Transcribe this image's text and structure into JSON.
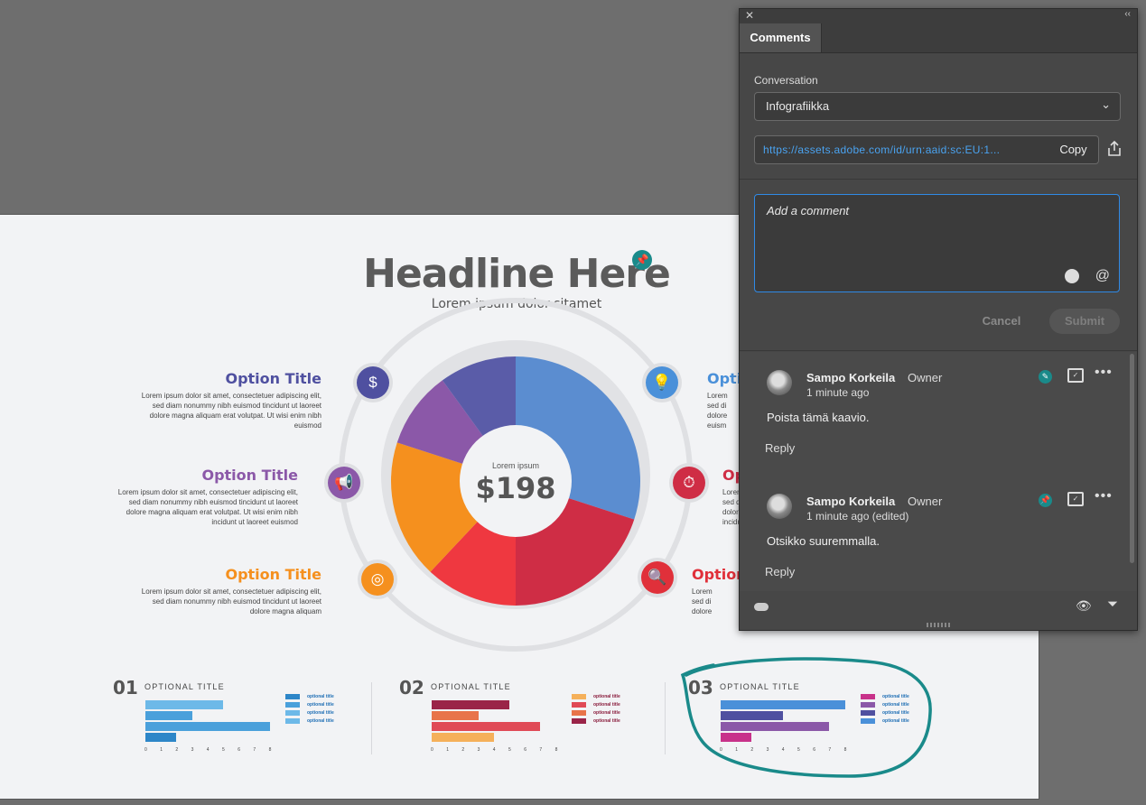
{
  "artboard": {
    "headline": "Headline Here",
    "subheadline": "Lorem ipsum dolor sitamet",
    "donut": {
      "center_label": "Lorem ipsum",
      "center_value": "$198",
      "slices": [
        {
          "value": 30,
          "color": "#5b8dd0"
        },
        {
          "value": 20,
          "color": "#cf2d45"
        },
        {
          "value": 12,
          "color": "#ef3840"
        },
        {
          "value": 18,
          "color": "#f5901e"
        },
        {
          "value": 10,
          "color": "#8b58a8"
        },
        {
          "value": 10,
          "color": "#5a5ca8"
        }
      ]
    },
    "options_left": [
      {
        "title": "Option Title",
        "color": "#4f50a0",
        "icon": "dollar-icon",
        "body": "Lorem ipsum dolor sit amet, consectetuer adipiscing elit, sed diam nonummy nibh euismod tincidunt ut laoreet dolore magna aliquam erat volutpat. Ut wisi enim nibh euismod"
      },
      {
        "title": "Option Title",
        "color": "#8b58a8",
        "icon": "megaphone-icon",
        "body": "Lorem ipsum dolor sit amet, consectetuer adipiscing elit, sed diam nonummy nibh euismod tincidunt ut laoreet dolore magna aliquam erat volutpat. Ut wisi enim nibh incidunt ut laoreet euismod"
      },
      {
        "title": "Option Title",
        "color": "#f5901e",
        "icon": "target-icon",
        "body": "Lorem ipsum dolor sit amet, consectetuer adipiscing elit, sed diam nonummy nibh euismod tincidunt ut laoreet dolore magna aliquam"
      }
    ],
    "options_right": [
      {
        "title": "Optio",
        "color": "#4a90d9",
        "icon": "lightbulb-icon",
        "body": "Lorem\nsed di\ndolore\neuism"
      },
      {
        "title": "Op",
        "color": "#cf2d45",
        "icon": "stopwatch-icon",
        "body": "Lorem\nsed di\ndolore\nincidu"
      },
      {
        "title": "Option",
        "color": "#e0303a",
        "icon": "magnifier-icon",
        "body": "Lorem\nsed di\ndolore"
      }
    ],
    "mini_charts": [
      {
        "number": "01",
        "title": "OPTIONAL TITLE",
        "legend_color": "#1f6fb5",
        "bars": [
          {
            "value": 5,
            "color": "#6db9e8"
          },
          {
            "value": 3,
            "color": "#4aa0db"
          },
          {
            "value": 8,
            "color": "#4aa0db"
          },
          {
            "value": 2,
            "color": "#2d86c8"
          }
        ],
        "legend_colors": [
          "#2d86c8",
          "#4aa0db",
          "#6db9e8",
          "#6db9e8"
        ]
      },
      {
        "number": "02",
        "title": "OPTIONAL TITLE",
        "legend_color": "#8a1d3d",
        "bars": [
          {
            "value": 5,
            "color": "#9a2448"
          },
          {
            "value": 3,
            "color": "#e8744a"
          },
          {
            "value": 7,
            "color": "#e04a56"
          },
          {
            "value": 4,
            "color": "#f5b05a"
          }
        ],
        "legend_colors": [
          "#f5b05a",
          "#e04a56",
          "#e8744a",
          "#9a2448"
        ]
      },
      {
        "number": "03",
        "title": "OPTIONAL TITLE",
        "legend_color": "#1f6fb5",
        "bars": [
          {
            "value": 8,
            "color": "#4a90d9"
          },
          {
            "value": 4,
            "color": "#4f50a0"
          },
          {
            "value": 7,
            "color": "#8b58a8"
          },
          {
            "value": 2,
            "color": "#c8328a"
          }
        ],
        "legend_colors": [
          "#c8328a",
          "#8b58a8",
          "#4f50a0",
          "#4a90d9"
        ]
      }
    ],
    "legend_label": "optional title",
    "axis_ticks": [
      "0",
      "1",
      "2",
      "3",
      "4",
      "5",
      "6",
      "7",
      "8"
    ],
    "annotation_color": "#1a8a8a"
  },
  "panel": {
    "tab": "Comments",
    "conversation_label": "Conversation",
    "conversation_value": "Infografiikka",
    "url": "https://assets.adobe.com/id/urn:aaid:sc:EU:1...",
    "copy_label": "Copy",
    "comment_placeholder": "Add a comment",
    "cancel_label": "Cancel",
    "submit_label": "Submit",
    "comments": [
      {
        "author": "Sampo Korkeila",
        "role": "Owner",
        "time": "1 minute ago",
        "text": "Poista tämä kaavio.",
        "reply": "Reply",
        "pin_glyph": "✎"
      },
      {
        "author": "Sampo Korkeila",
        "role": "Owner",
        "time": "1 minute ago (edited)",
        "text": "Otsikko suuremmalla.",
        "reply": "Reply",
        "pin_glyph": "📌"
      }
    ],
    "accent_color": "#2f8ae6",
    "link_color": "#4aa3f0"
  }
}
